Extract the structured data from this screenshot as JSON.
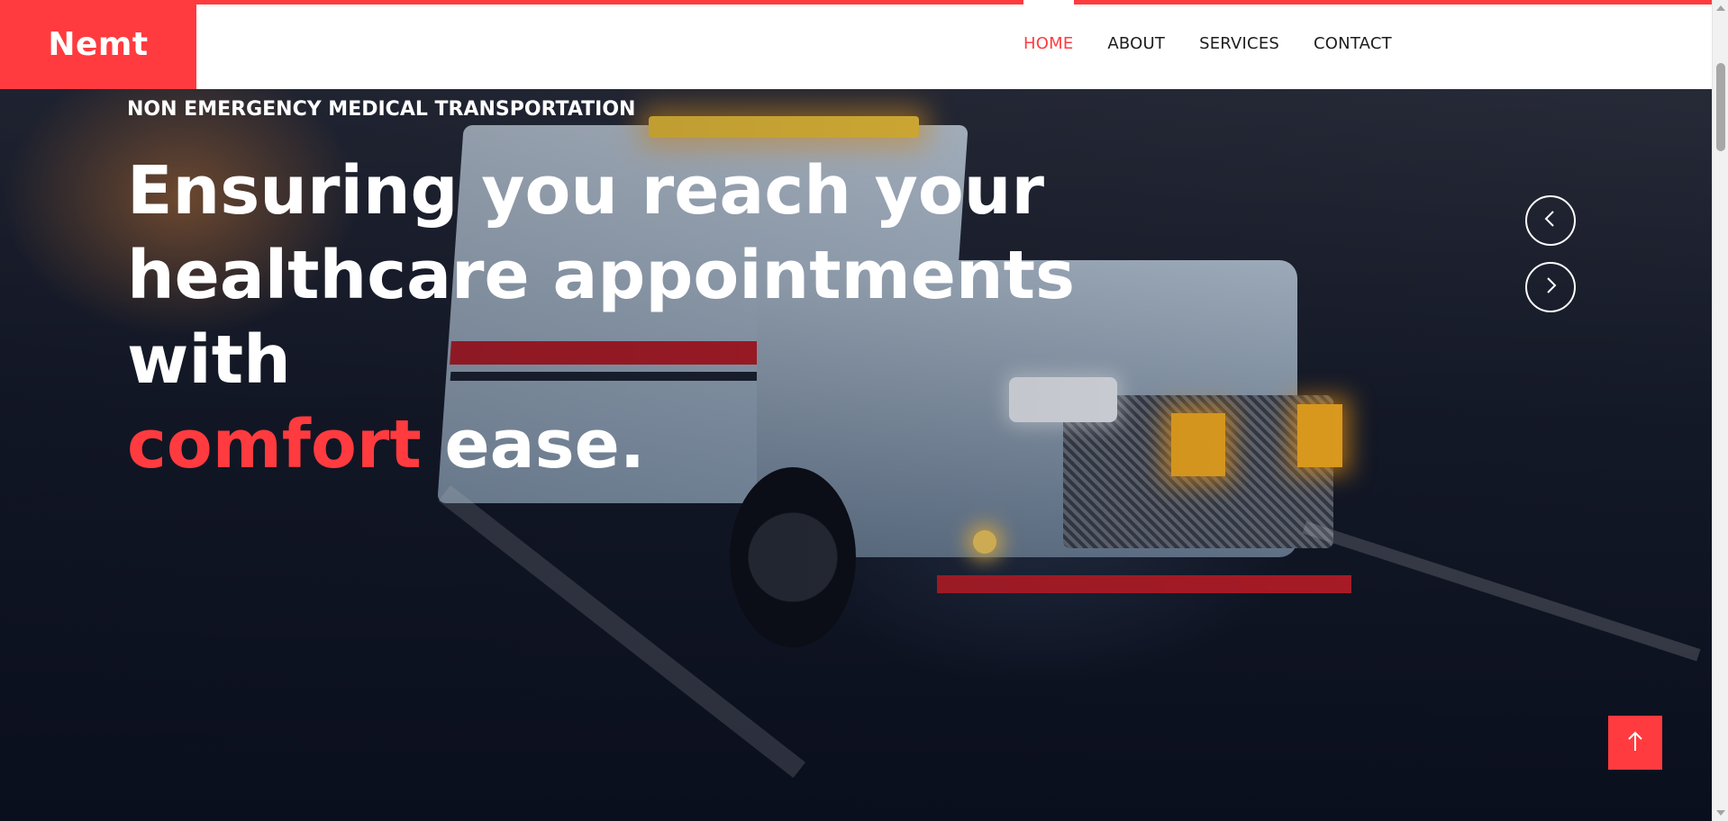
{
  "brand": {
    "name": "Nemt"
  },
  "nav": {
    "items": [
      {
        "label": "HOME",
        "active": true
      },
      {
        "label": "ABOUT",
        "active": false
      },
      {
        "label": "SERVICES",
        "active": false
      },
      {
        "label": "CONTACT",
        "active": false
      }
    ]
  },
  "hero": {
    "eyebrow": "NON EMERGENCY MEDICAL TRANSPORTATION",
    "headline_part1": "Ensuring you reach your healthcare appointments with",
    "headline_accent": "comfort",
    "headline_part2": "ease.",
    "prev_icon": "chevron-left-icon",
    "next_icon": "chevron-right-icon"
  },
  "back_to_top": {
    "icon": "arrow-up-icon"
  },
  "colors": {
    "accent": "#ff3b3f",
    "header_bg": "#ffffff",
    "text_dark": "#1d1d1d",
    "text_light": "#ffffff"
  }
}
